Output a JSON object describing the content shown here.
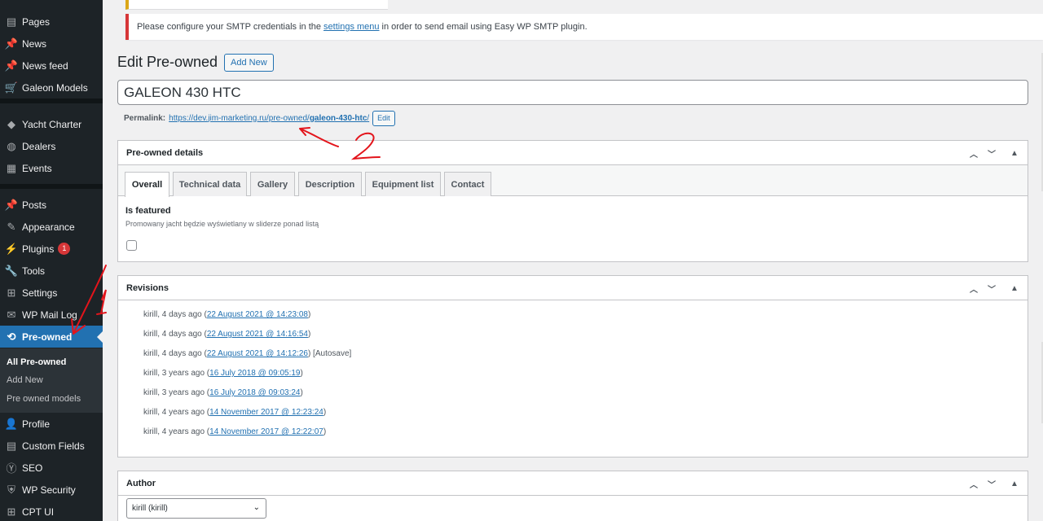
{
  "sidebar": {
    "items": [
      {
        "label": "Pages",
        "icon": "pages-icon",
        "glyph": "▤"
      },
      {
        "label": "News",
        "icon": "pin-icon",
        "glyph": "📌"
      },
      {
        "label": "News feed",
        "icon": "pin-icon",
        "glyph": "📌"
      },
      {
        "label": "Galeon Models",
        "icon": "cart-icon",
        "glyph": "🛒"
      },
      {
        "label": "Yacht Charter",
        "icon": "tag-icon",
        "glyph": "◆"
      },
      {
        "label": "Dealers",
        "icon": "globe-icon",
        "glyph": "◍"
      },
      {
        "label": "Events",
        "icon": "list-icon",
        "glyph": "▦"
      },
      {
        "label": "Posts",
        "icon": "pin-icon",
        "glyph": "📌"
      },
      {
        "label": "Appearance",
        "icon": "brush-icon",
        "glyph": "✎"
      },
      {
        "label": "Plugins",
        "icon": "plug-icon",
        "glyph": "⚡",
        "badge": "1"
      },
      {
        "label": "Tools",
        "icon": "wrench-icon",
        "glyph": "🔧"
      },
      {
        "label": "Settings",
        "icon": "settings-icon",
        "glyph": "⊞"
      },
      {
        "label": "WP Mail Log",
        "icon": "mail-icon",
        "glyph": "✉"
      },
      {
        "label": "Pre-owned",
        "icon": "sync-icon",
        "glyph": "⟲"
      },
      {
        "label": "Profile",
        "icon": "user-icon",
        "glyph": "👤"
      },
      {
        "label": "Custom Fields",
        "icon": "fields-icon",
        "glyph": "▤"
      },
      {
        "label": "SEO",
        "icon": "seo-icon",
        "glyph": "Ⓨ"
      },
      {
        "label": "WP Security",
        "icon": "shield-icon",
        "glyph": "⛨"
      },
      {
        "label": "CPT UI",
        "icon": "grid-icon",
        "glyph": "⊞"
      }
    ],
    "submenu": [
      "All Pre-owned",
      "Add New",
      "Pre owned models"
    ]
  },
  "notice": {
    "before": "Please configure your SMTP credentials in the",
    "link": "settings menu",
    "after": "in order to send email using Easy WP SMTP plugin."
  },
  "page": {
    "title": "Edit Pre-owned",
    "add_new": "Add New",
    "post_title": "GALEON 430 HTC",
    "permalink_label": "Permalink:",
    "permalink_base": "https://dev.jim-marketing.ru/pre-owned/",
    "permalink_slug": "galeon-430-htc",
    "permalink_end": "/",
    "edit_label": "Edit"
  },
  "details_box": {
    "title": "Pre-owned details",
    "tabs": [
      "Overall",
      "Technical data",
      "Gallery",
      "Description",
      "Equipment list",
      "Contact"
    ],
    "active_tab": "Overall",
    "field_label": "Is featured",
    "field_desc": "Promowany jacht będzie wyświetlany w sliderze ponad listą"
  },
  "revisions_box": {
    "title": "Revisions",
    "items": [
      {
        "who": "kirill, 4 days ago (",
        "link": "22 August 2021 @ 14:23:08",
        "suffix": ")"
      },
      {
        "who": "kirill, 4 days ago (",
        "link": "22 August 2021 @ 14:16:54",
        "suffix": ")"
      },
      {
        "who": "kirill, 4 days ago (",
        "link": "22 August 2021 @ 14:12:26",
        "suffix": ") [Autosave]"
      },
      {
        "who": "kirill, 3 years ago (",
        "link": "16 July 2018 @ 09:05:19",
        "suffix": ")"
      },
      {
        "who": "kirill, 3 years ago (",
        "link": "16 July 2018 @ 09:03:24",
        "suffix": ")"
      },
      {
        "who": "kirill, 4 years ago (",
        "link": "14 November 2017 @ 12:23:24",
        "suffix": ")"
      },
      {
        "who": "kirill, 4 years ago (",
        "link": "14 November 2017 @ 12:22:07",
        "suffix": ")"
      }
    ]
  },
  "author_box": {
    "title": "Author",
    "selected": "kirill (kirill)"
  },
  "annotations": {
    "label_1": "1",
    "label_2": "2",
    "color": "#e3141b"
  },
  "colors": {
    "sidebar_bg": "#1d2327",
    "accent": "#2271b1",
    "error": "#d63638",
    "warning": "#dba617"
  }
}
